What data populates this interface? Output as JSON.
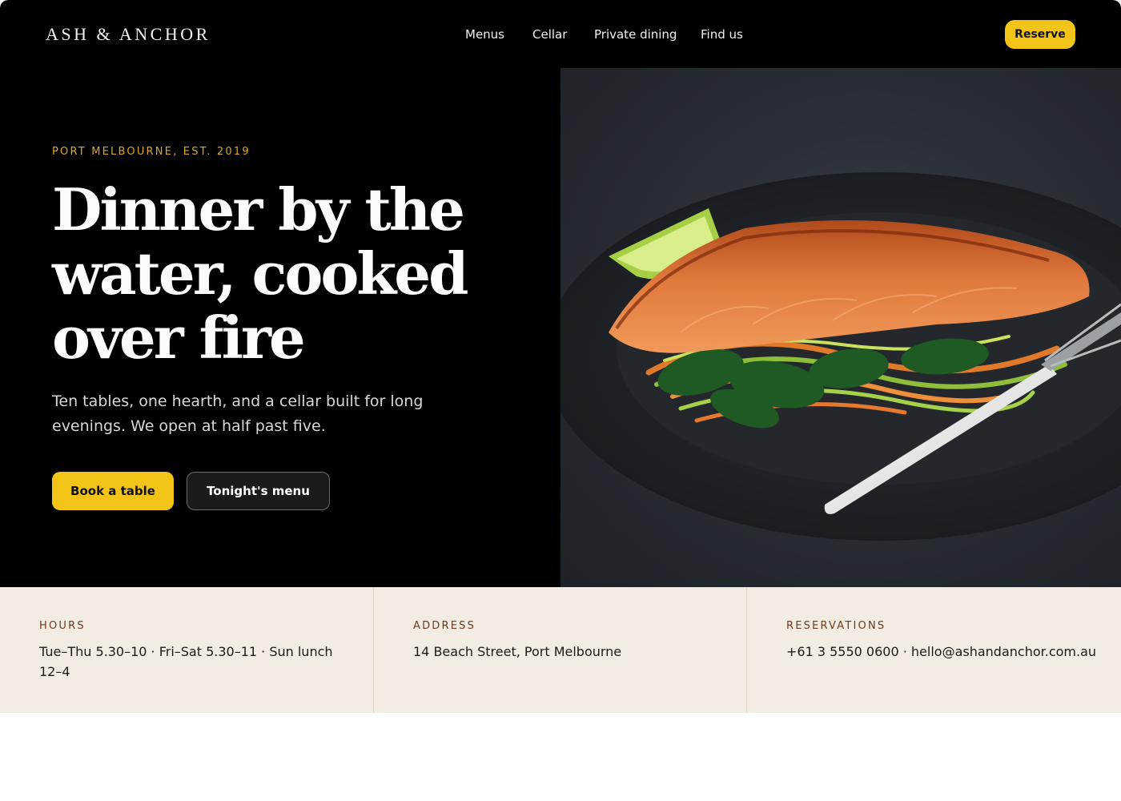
{
  "header": {
    "brand": "ASH & ANCHOR",
    "nav": [
      "Menus",
      "Cellar",
      "Private dining",
      "Find us"
    ],
    "reserve_label": "Reserve"
  },
  "hero": {
    "eyebrow": "PORT MELBOURNE, EST. 2019",
    "headline": "Dinner by the water, cooked over fire",
    "subtitle": "Ten tables, one hearth, and a cellar built for long evenings. We open at half past five.",
    "primary_cta": "Book a table",
    "secondary_cta": "Tonight's menu"
  },
  "info": [
    {
      "label": "HOURS",
      "value": "Tue–Thu 5.30–10 · Fri–Sat 5.30–11 · Sun lunch 12–4"
    },
    {
      "label": "ADDRESS",
      "value": "14 Beach Street, Port Melbourne"
    },
    {
      "label": "RESERVATIONS",
      "value": "+61 3 5550 0600 · hello@ashandanchor.com.au"
    }
  ],
  "colors": {
    "accent": "#f2c417",
    "eyebrow": "#d9a92a",
    "band": "#f3ece2",
    "label": "#6b3a1c"
  },
  "image": {
    "subject": "grilled salmon fillet with vegetable ribbons, lime wedge and white-handled fork on dark plate"
  }
}
